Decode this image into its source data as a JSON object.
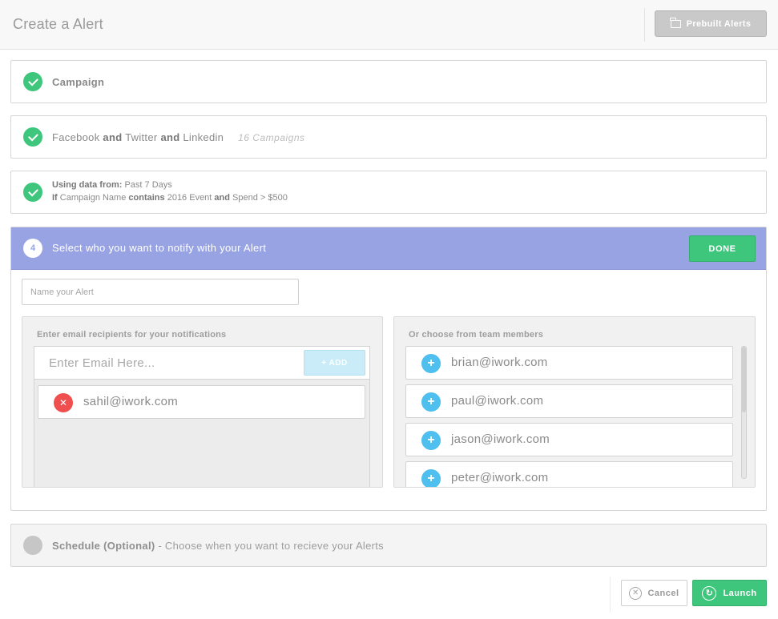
{
  "header": {
    "title": "Create a Alert",
    "prebuilt_label": "Prebuilt Alerts",
    "prebuilt_icon": "folder-icon"
  },
  "steps": {
    "campaign": {
      "label": "Campaign",
      "status": "complete"
    },
    "networks": {
      "part1": "Facebook",
      "and1": "and",
      "part2": "Twitter",
      "and2": "and",
      "part3": "Linkedin",
      "count": "16 Campaigns",
      "status": "complete"
    },
    "conditions": {
      "data_label": "Using data from:",
      "data_value": "Past 7 Days",
      "if_label": "If",
      "field": "Campaign Name",
      "operator": "contains",
      "value": "2016 Event",
      "and_label": "and",
      "condition2": "Spend > $500",
      "status": "complete"
    },
    "notify": {
      "number": "4",
      "label": "Select who you want to notify with your Alert",
      "done_label": "DONE",
      "alert_name_placeholder": "Name your Alert",
      "recipients_title": "Enter email recipients for your notifications",
      "email_placeholder": "Enter Email Here...",
      "add_label": "+ ADD",
      "recipients": [
        "sahil@iwork.com"
      ],
      "team_title": "Or choose from team members",
      "team_members": [
        "brian@iwork.com",
        "paul@iwork.com",
        "jason@iwork.com",
        "peter@iwork.com"
      ]
    },
    "schedule": {
      "title": "Schedule (Optional)",
      "desc": " - Choose when you want to recieve your Alerts"
    }
  },
  "footer": {
    "cancel_label": "Cancel",
    "launch_label": "Launch"
  },
  "colors": {
    "accent_green": "#3ec77c",
    "active_step": "#98a3e3",
    "remove_red": "#f04f4f",
    "add_blue": "#4ebfee"
  }
}
